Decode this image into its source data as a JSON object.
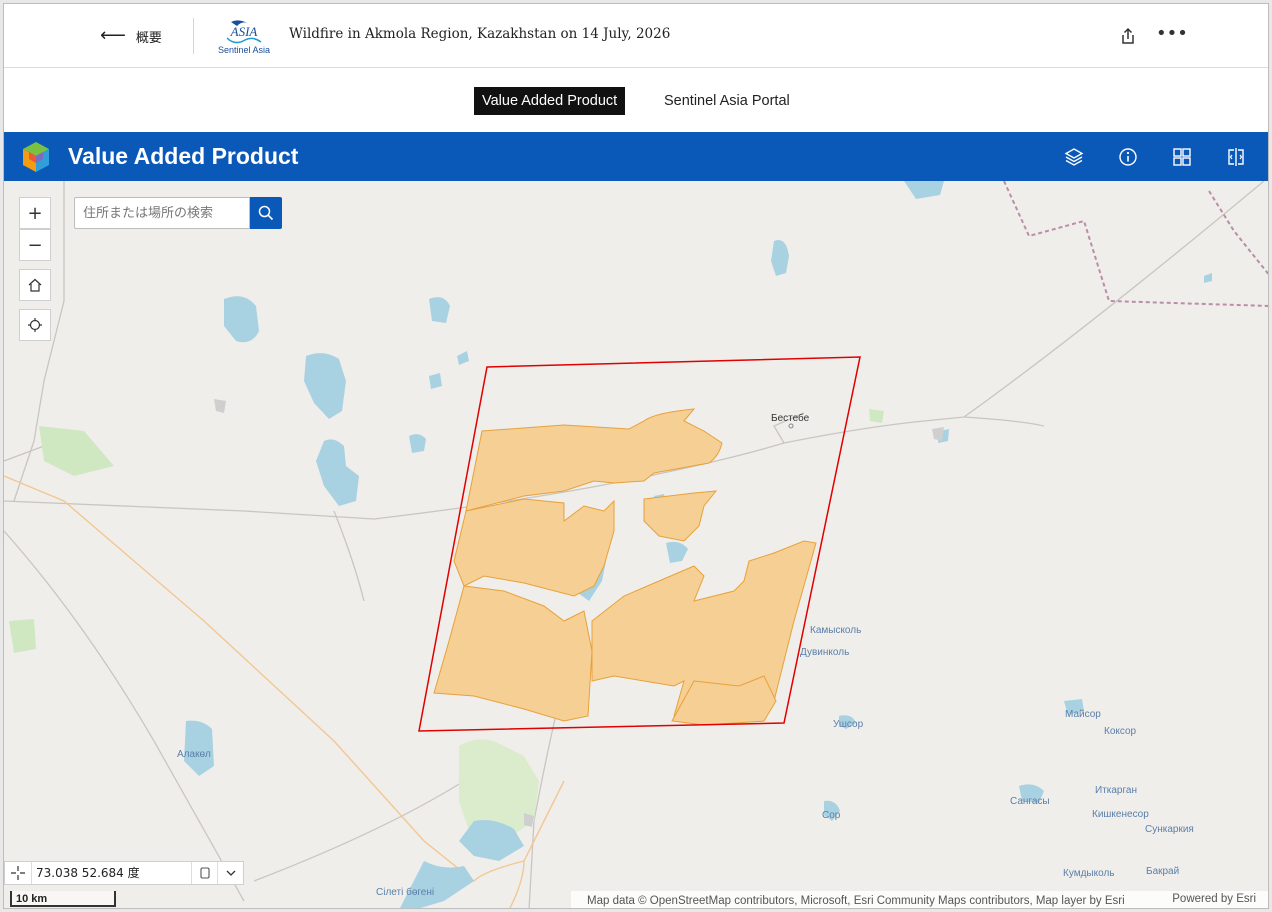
{
  "header": {
    "back_label": "概要",
    "story_title": "Wildfire in Akmola Region, Kazakhstan on 14 July, 2026",
    "logo_text_top": "ASIA",
    "logo_text_bottom": "Sentinel Asia"
  },
  "tabs": [
    {
      "label": "Value Added Product",
      "active": true
    },
    {
      "label": "Sentinel Asia Portal",
      "active": false
    }
  ],
  "app": {
    "title": "Value Added Product",
    "header_icons": [
      "layers-icon",
      "info-icon",
      "basemap-gallery-icon",
      "swipe-compare-icon"
    ]
  },
  "search": {
    "placeholder": "住所または場所の検索",
    "value": ""
  },
  "map": {
    "places": [
      "Бестебе",
      "Камысколь",
      "Дувинколь",
      "Ушсор",
      "Майсор",
      "Коксор",
      "Иткарган",
      "Сангасы",
      "Кишкенесор",
      "Сункаркия",
      "Сор",
      "Бакрай",
      "Кумдыколь",
      "Алакөл",
      "Сілеті бөгені"
    ],
    "burn_area_color": "#f5cf93",
    "burn_outline_color": "#e8a13a",
    "footprint_color": "#e00000",
    "water_color": "#a8d2e2"
  },
  "coordinates": {
    "text": "73.038 52.684 度"
  },
  "scale": {
    "label": "10 km"
  },
  "attribution": {
    "text": "Map data © OpenStreetMap contributors, Microsoft, Esri Community Maps contributors, Map layer by Esri",
    "powered_by": "Powered by Esri"
  }
}
